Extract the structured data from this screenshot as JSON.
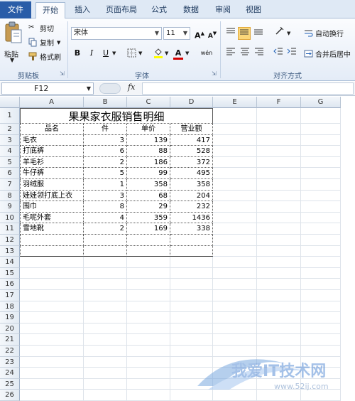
{
  "tabs": {
    "file": "文件",
    "items": [
      "开始",
      "插入",
      "页面布局",
      "公式",
      "数据",
      "审阅",
      "视图"
    ],
    "active": "开始"
  },
  "clipboard": {
    "paste": "粘贴",
    "cut": "剪切",
    "copy": "复制",
    "format_painter": "格式刷",
    "label": "剪贴板"
  },
  "font": {
    "name": "宋体",
    "size": "11",
    "bold": "B",
    "italic": "I",
    "underline": "U",
    "grow": "A",
    "shrink": "A",
    "font_color_letter": "A",
    "phonetic": "wén",
    "label": "字体"
  },
  "alignment": {
    "wrap_text": "自动换行",
    "merge_center": "合并后居中",
    "label": "对齐方式"
  },
  "formula_bar": {
    "name_box": "F12",
    "fx": "fx",
    "value": ""
  },
  "columns": [
    "A",
    "B",
    "C",
    "D",
    "E",
    "F",
    "G"
  ],
  "rows": [
    "1",
    "2",
    "3",
    "4",
    "5",
    "6",
    "7",
    "8",
    "9",
    "10",
    "11",
    "12",
    "13",
    "14",
    "15",
    "16",
    "17",
    "18",
    "19",
    "20",
    "21",
    "22",
    "23",
    "24",
    "25",
    "26"
  ],
  "sheet": {
    "title": "果果家衣服销售明细",
    "headers": [
      "品名",
      "件",
      "单价",
      "营业额"
    ],
    "data": [
      [
        "毛衣",
        "3",
        "139",
        "417"
      ],
      [
        "打底裤",
        "6",
        "88",
        "528"
      ],
      [
        "羊毛衫",
        "2",
        "186",
        "372"
      ],
      [
        "牛仔裤",
        "5",
        "99",
        "495"
      ],
      [
        "羽绒服",
        "1",
        "358",
        "358"
      ],
      [
        "娃娃领打底上衣",
        "3",
        "68",
        "204"
      ],
      [
        "围巾",
        "8",
        "29",
        "232"
      ],
      [
        "毛呢外套",
        "4",
        "359",
        "1436"
      ],
      [
        "雪地靴",
        "2",
        "169",
        "338"
      ]
    ]
  },
  "watermark": {
    "text": "我爱IT技术网",
    "url": "www.52ij.com"
  },
  "colors": {
    "file_tab": "#2a5da8",
    "ribbon": "#e4ecf7",
    "font_color": "#d40000",
    "fill_color": "#ffff00"
  }
}
